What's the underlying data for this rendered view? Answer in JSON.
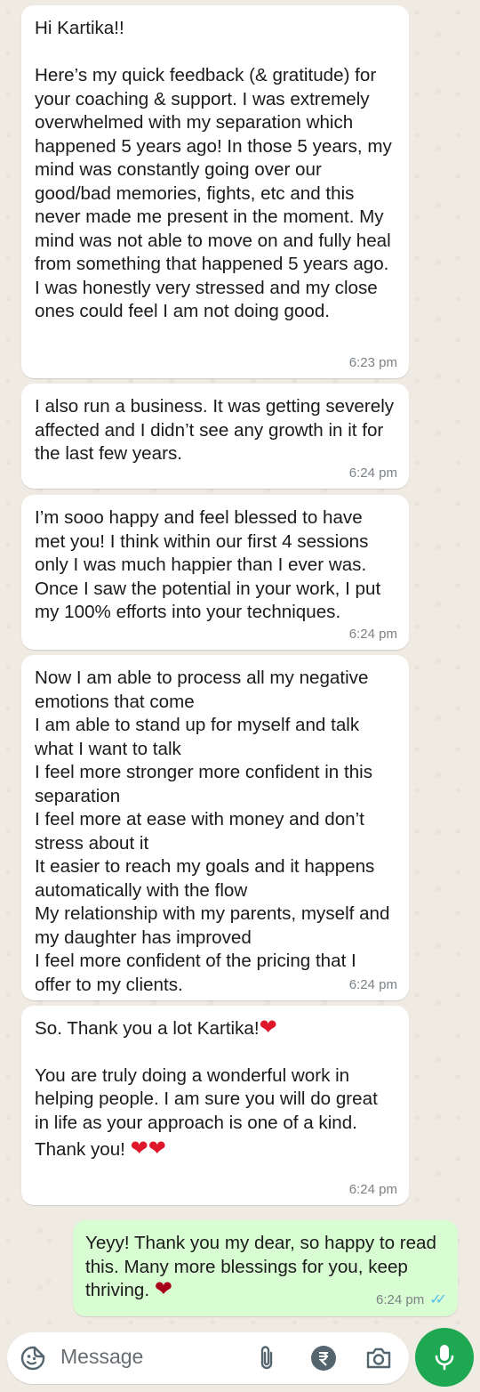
{
  "messages": [
    {
      "id": "m1",
      "direction": "incoming",
      "text": "Hi Kartika!!\n\nHere’s my quick feedback (& gratitude) for your coaching & support. I was extremely overwhelmed with my separation which happened 5 years ago! In those 5 years, my mind was constantly going over our good/bad memories, fights, etc and this never made me present in the moment. My mind was not able to move on and fully heal from something that happened 5 years ago. I was honestly very stressed and my close ones could feel I am not doing good.",
      "time": "6:23 pm"
    },
    {
      "id": "m2",
      "direction": "incoming",
      "text": "I also run a business. It was getting severely affected and I didn’t see any growth in it for the last few years.",
      "time": "6:24 pm"
    },
    {
      "id": "m3",
      "direction": "incoming",
      "text": "I’m sooo happy and feel blessed to have met you! I think within our first 4 sessions only I was much happier than I ever was. Once I saw the potential in your work, I put my 100% efforts into your techniques.",
      "time": "6:24 pm"
    },
    {
      "id": "m4",
      "direction": "incoming",
      "text": "Now I am able to process all my negative emotions that come\nI am able to stand up for myself and talk what I want to talk\nI feel more stronger more confident in this separation\nI feel more at ease with money and don’t stress about it\nIt easier to reach my goals and it happens automatically with the flow\nMy relationship with my parents, myself and my daughter has improved\nI feel more confident of the pricing that I offer to my clients.",
      "time": "6:24 pm"
    },
    {
      "id": "m5",
      "direction": "incoming",
      "text_a": "So. Thank you a lot Kartika!",
      "heart_a": "❤",
      "text_b": "You are truly doing a wonderful work in helping people. I am sure you will do great in life as your approach is one of a kind.",
      "text_c": "Thank you! ",
      "heart_c": "❤❤",
      "time": "6:24 pm"
    },
    {
      "id": "m6",
      "direction": "outgoing",
      "text": "Yeyy! Thank you my dear, so happy to read this. Many more blessings for you, keep thriving. ",
      "heart": "❤",
      "time": "6:24 pm",
      "status": "read"
    }
  ],
  "composer": {
    "placeholder": "Message",
    "icons": [
      "emoji-sticker-icon",
      "attach-icon",
      "rupee-payment-icon",
      "camera-icon",
      "mic-icon"
    ]
  },
  "colors": {
    "wallpaper": "#efeae2",
    "incoming_bubble": "#ffffff",
    "outgoing_bubble": "#d9fdd3",
    "read_ticks": "#53bdeb",
    "mic_button": "#1da851",
    "heart": "#e0162b"
  }
}
